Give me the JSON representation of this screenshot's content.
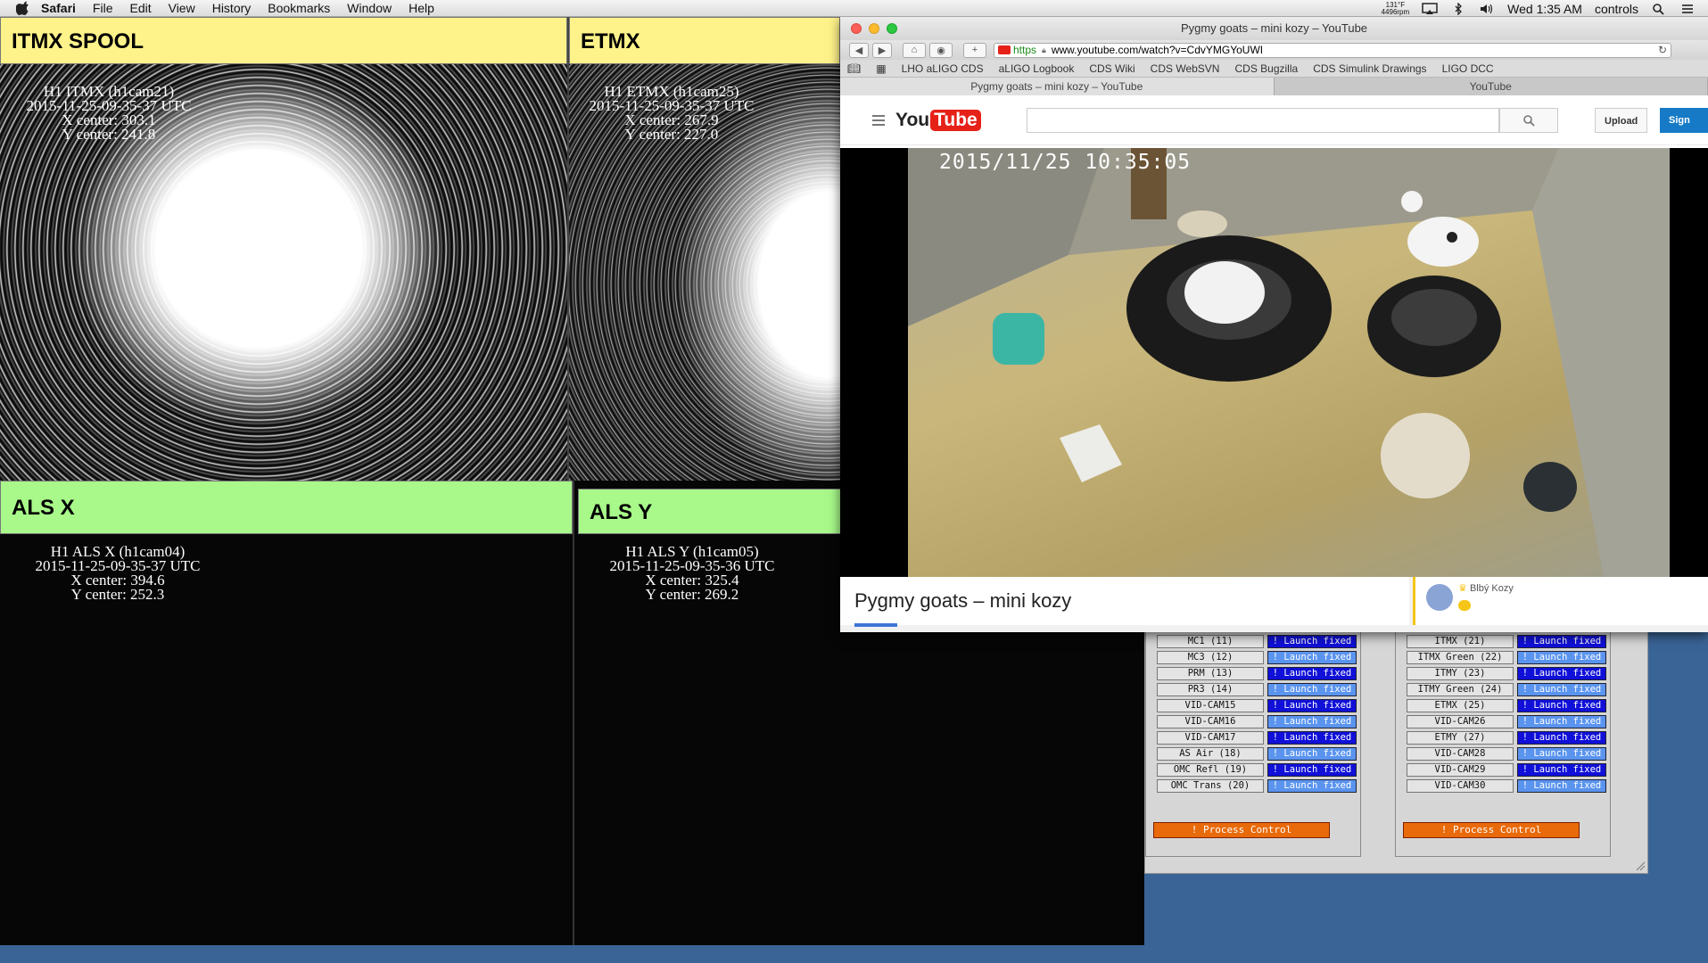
{
  "menubar": {
    "app": "Safari",
    "items": [
      "File",
      "Edit",
      "View",
      "History",
      "Bookmarks",
      "Window",
      "Help"
    ],
    "temp_line1": "131°F",
    "temp_line2": "4496rpm",
    "clock": "Wed 1:35 AM",
    "user": "controls"
  },
  "panels": {
    "itmx": {
      "header": "ITMX SPOOL",
      "lines": [
        "H1 ITMX (h1cam21)",
        "2015-11-25-09-35-37 UTC",
        "X center: 303.1",
        "Y center: 241.8"
      ]
    },
    "etmx": {
      "header": "ETMX",
      "lines": [
        "H1 ETMX (h1cam25)",
        "2015-11-25-09-35-37 UTC",
        "X center: 267.9",
        "Y center: 227.0"
      ]
    },
    "alsx": {
      "header": "ALS X",
      "lines": [
        "H1 ALS X (h1cam04)",
        "2015-11-25-09-35-37 UTC",
        "X center: 394.6",
        "Y center: 252.3"
      ]
    },
    "alsy": {
      "header": "ALS Y",
      "lines": [
        "H1 ALS Y (h1cam05)",
        "2015-11-25-09-35-36 UTC",
        "X center: 325.4",
        "Y center: 269.2"
      ]
    }
  },
  "safari": {
    "window_title": "Pygmy goats – mini kozy – YouTube",
    "url_scheme": "https",
    "url": "www.youtube.com/watch?v=CdvYMGYoUWI",
    "bookmarks": [
      "LHO aLIGO CDS",
      "aLIGO Logbook",
      "CDS Wiki",
      "CDS WebSVN",
      "CDS Bugzilla",
      "CDS Simulink Drawings",
      "LIGO DCC"
    ],
    "tabs": [
      "Pygmy goats – mini kozy – YouTube",
      "YouTube"
    ]
  },
  "youtube": {
    "logo_you": "You",
    "logo_tube": "Tube",
    "upload_label": "Upload",
    "signin_label": "Sign in",
    "video_timestamp": "2015/11/25 10:35:05",
    "video_title": "Pygmy goats – mini kozy",
    "channel_name": "Blbý Kozy"
  },
  "control": {
    "launch_label": "! Launch fixed",
    "process_label": "! Process Control",
    "left_cams": [
      "MC1 (11)",
      "MC3 (12)",
      "PRM (13)",
      "PR3 (14)",
      "VID-CAM15",
      "VID-CAM16",
      "VID-CAM17",
      "AS Air (18)",
      "OMC Refl (19)",
      "OMC Trans (20)"
    ],
    "right_cams": [
      "ITMX (21)",
      "ITMX Green (22)",
      "ITMY (23)",
      "ITMY Green (24)",
      "ETMX (25)",
      "VID-CAM26",
      "ETMY (27)",
      "VID-CAM28",
      "VID-CAM29",
      "VID-CAM30"
    ]
  },
  "colors": {
    "yellow_header": "#fef28a",
    "green_header": "#a8f98a",
    "launch_dark": "#1010d8",
    "launch_light": "#5a94ee",
    "process": "#e86a0a",
    "youtube_red": "#e62117",
    "signin_blue": "#167ac6"
  }
}
